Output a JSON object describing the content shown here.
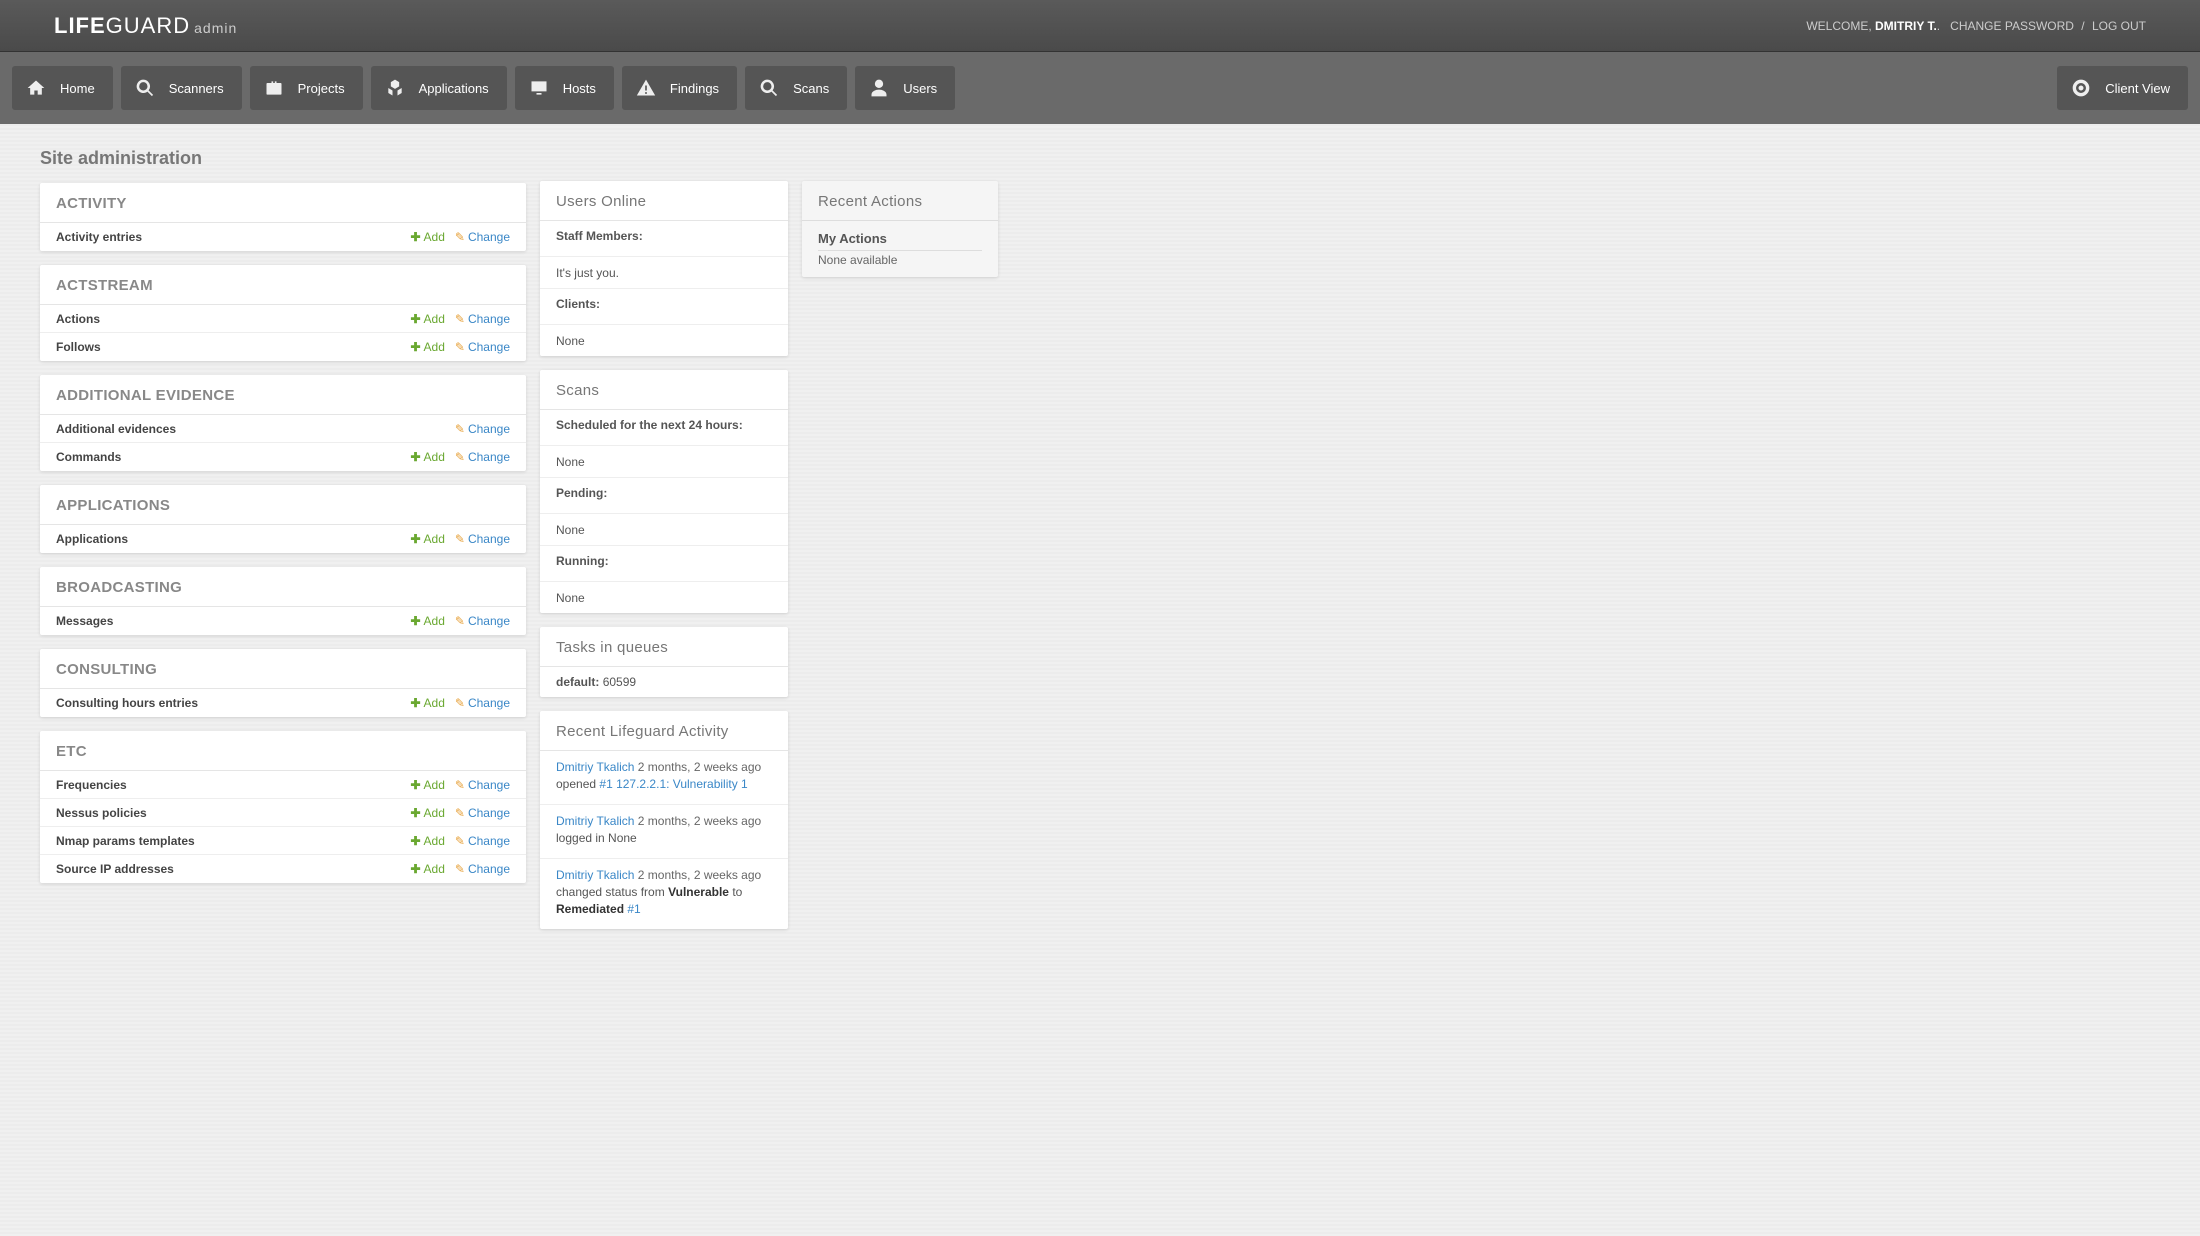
{
  "header": {
    "brand_bold": "LIFE",
    "brand_light": "GUARD",
    "brand_suffix": "admin",
    "welcome_prefix": "WELCOME, ",
    "user_name": "DMITRIY T.",
    "change_password": "CHANGE PASSWORD",
    "logout": "LOG OUT"
  },
  "nav": {
    "home": "Home",
    "scanners": "Scanners",
    "projects": "Projects",
    "applications": "Applications",
    "hosts": "Hosts",
    "findings": "Findings",
    "scans": "Scans",
    "users": "Users",
    "client_view": "Client View"
  },
  "page_title": "Site administration",
  "labels": {
    "add": "Add",
    "change": "Change"
  },
  "modules": [
    {
      "title": "ACTIVITY",
      "rows": [
        {
          "name": "Activity entries",
          "add": true,
          "change": true
        }
      ]
    },
    {
      "title": "ACTSTREAM",
      "rows": [
        {
          "name": "Actions",
          "add": true,
          "change": true
        },
        {
          "name": "Follows",
          "add": true,
          "change": true
        }
      ]
    },
    {
      "title": "ADDITIONAL EVIDENCE",
      "rows": [
        {
          "name": "Additional evidences",
          "add": false,
          "change": true
        },
        {
          "name": "Commands",
          "add": true,
          "change": true
        }
      ]
    },
    {
      "title": "APPLICATIONS",
      "rows": [
        {
          "name": "Applications",
          "add": true,
          "change": true
        }
      ]
    },
    {
      "title": "BROADCASTING",
      "rows": [
        {
          "name": "Messages",
          "add": true,
          "change": true
        }
      ]
    },
    {
      "title": "CONSULTING",
      "rows": [
        {
          "name": "Consulting hours entries",
          "add": true,
          "change": true
        }
      ]
    },
    {
      "title": "ETC",
      "rows": [
        {
          "name": "Frequencies",
          "add": true,
          "change": true
        },
        {
          "name": "Nessus policies",
          "add": true,
          "change": true
        },
        {
          "name": "Nmap params templates",
          "add": true,
          "change": true
        },
        {
          "name": "Source IP addresses",
          "add": true,
          "change": true
        }
      ]
    }
  ],
  "users_online": {
    "title": "Users Online",
    "staff_label": "Staff Members:",
    "staff_value": "It's just you.",
    "clients_label": "Clients:",
    "clients_value": "None"
  },
  "scans_panel": {
    "title": "Scans",
    "scheduled_label": "Scheduled for the next 24 hours:",
    "scheduled_value": "None",
    "pending_label": "Pending:",
    "pending_value": "None",
    "running_label": "Running:",
    "running_value": "None"
  },
  "tasks": {
    "title": "Tasks in queues",
    "default_label": "default:",
    "default_value": "60599"
  },
  "recent_lg": {
    "title": "Recent Lifeguard Activity",
    "entries": [
      {
        "user": "Dmitriy Tkalich",
        "time": "2 months, 2 weeks ago",
        "verb_pre": "",
        "verb": "opened ",
        "object": "#1 127.2.2.1: Vulnerability 1",
        "verb_post": ""
      },
      {
        "user": "Dmitriy Tkalich",
        "time": "2 months, 2 weeks ago",
        "verb_pre": "",
        "verb": "logged in ",
        "plain_post": "None"
      },
      {
        "user": "Dmitriy Tkalich",
        "time": "2 months, 2 weeks ago",
        "verb": "changed status from ",
        "strong1": "Vulnerable",
        "mid": " to ",
        "strong2": "Remediated",
        "object": " #1"
      }
    ]
  },
  "recent_actions": {
    "title": "Recent Actions",
    "my_actions": "My Actions",
    "none": "None available"
  }
}
